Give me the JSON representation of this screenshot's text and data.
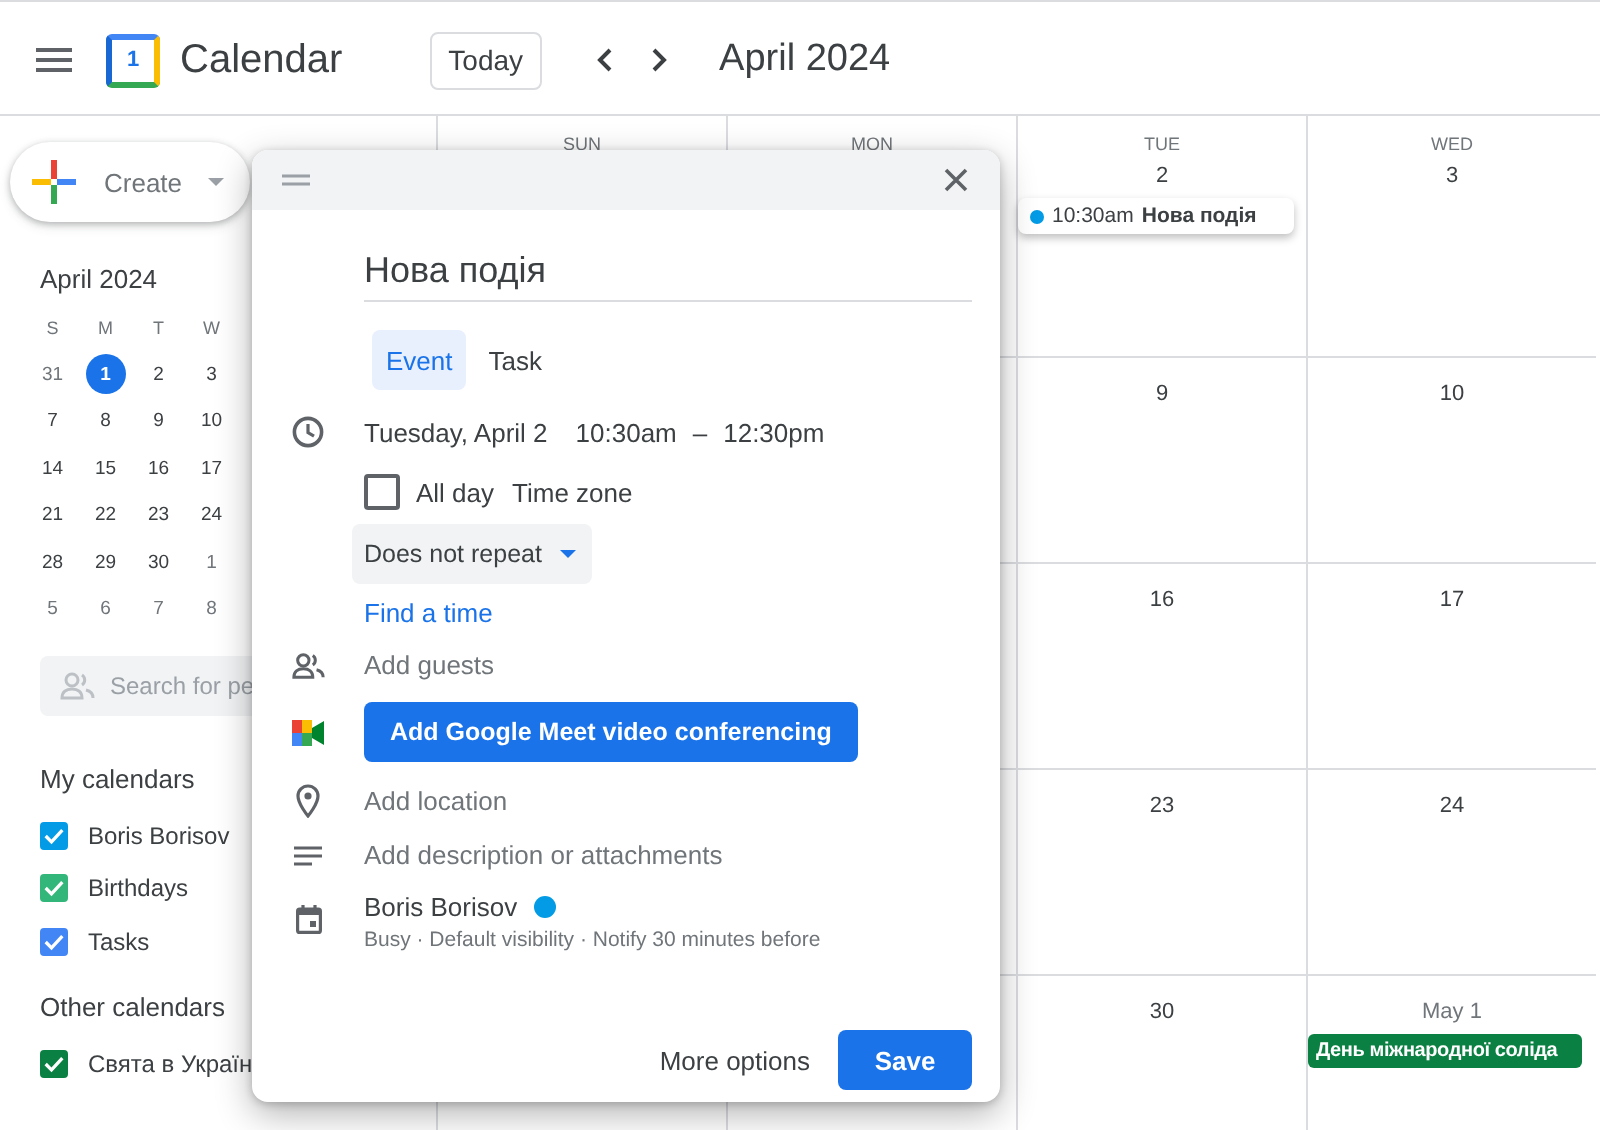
{
  "header": {
    "logo_text": "1",
    "app_name": "Calendar",
    "today_button": "Today",
    "period": "April 2024"
  },
  "sidebar": {
    "create_button": "Create",
    "mini_calendar": {
      "title": "April 2024",
      "weekdays": [
        "S",
        "M",
        "T",
        "W"
      ],
      "weeks": [
        [
          {
            "d": "31",
            "outside": true,
            "today": false
          },
          {
            "d": "1",
            "outside": false,
            "today": true
          },
          {
            "d": "2",
            "outside": false,
            "today": false
          },
          {
            "d": "3",
            "outside": false,
            "today": false
          }
        ],
        [
          {
            "d": "7",
            "outside": false,
            "today": false
          },
          {
            "d": "8",
            "outside": false,
            "today": false
          },
          {
            "d": "9",
            "outside": false,
            "today": false
          },
          {
            "d": "10",
            "outside": false,
            "today": false
          }
        ],
        [
          {
            "d": "14",
            "outside": false,
            "today": false
          },
          {
            "d": "15",
            "outside": false,
            "today": false
          },
          {
            "d": "16",
            "outside": false,
            "today": false
          },
          {
            "d": "17",
            "outside": false,
            "today": false
          }
        ],
        [
          {
            "d": "21",
            "outside": false,
            "today": false
          },
          {
            "d": "22",
            "outside": false,
            "today": false
          },
          {
            "d": "23",
            "outside": false,
            "today": false
          },
          {
            "d": "24",
            "outside": false,
            "today": false
          }
        ],
        [
          {
            "d": "28",
            "outside": false,
            "today": false
          },
          {
            "d": "29",
            "outside": false,
            "today": false
          },
          {
            "d": "30",
            "outside": false,
            "today": false
          },
          {
            "d": "1",
            "outside": true,
            "today": false
          }
        ],
        [
          {
            "d": "5",
            "outside": true,
            "today": false
          },
          {
            "d": "6",
            "outside": true,
            "today": false
          },
          {
            "d": "7",
            "outside": true,
            "today": false
          },
          {
            "d": "8",
            "outside": true,
            "today": false
          }
        ]
      ]
    },
    "search": {
      "placeholder": "Search for pe"
    },
    "my_calendars": {
      "title": "My calendars",
      "items": [
        {
          "label": "Boris Borisov",
          "checked": true,
          "color": "#039be5"
        },
        {
          "label": "Birthdays",
          "checked": true,
          "color": "#33b679"
        },
        {
          "label": "Tasks",
          "checked": true,
          "color": "#4285f4"
        }
      ]
    },
    "other_calendars": {
      "title": "Other calendars",
      "items": [
        {
          "label": "Свята в Україн",
          "checked": true,
          "color": "#0b8043"
        }
      ]
    }
  },
  "grid": {
    "columns": [
      "SUN",
      "MON",
      "TUE",
      "WED"
    ],
    "weeks": [
      {
        "days": [
          {
            "date": "2",
            "outside": false,
            "events": [
              {
                "kind": "timed",
                "time": "10:30am",
                "title": "Нова подія",
                "color": "#039be5"
              }
            ]
          },
          {
            "date": "3",
            "outside": false
          }
        ]
      },
      {
        "days": [
          {
            "date": "9",
            "outside": false
          },
          {
            "date": "10",
            "outside": false
          }
        ]
      },
      {
        "days": [
          {
            "date": "16",
            "outside": false
          },
          {
            "date": "17",
            "outside": false
          }
        ]
      },
      {
        "days": [
          {
            "date": "23",
            "outside": false
          },
          {
            "date": "24",
            "outside": false
          }
        ]
      },
      {
        "days": [
          {
            "date": "30",
            "outside": false
          },
          {
            "date": "May 1",
            "outside": true,
            "events": [
              {
                "kind": "allday",
                "title": "День міжнародної соліда",
                "color": "#0b8043"
              }
            ]
          }
        ]
      }
    ]
  },
  "dialog": {
    "title_value": "Нова подія",
    "tabs": [
      {
        "label": "Event",
        "selected": true
      },
      {
        "label": "Task",
        "selected": false
      }
    ],
    "date": "Tuesday, April 2",
    "start": "10:30am",
    "dash": "–",
    "end": "12:30pm",
    "all_day": {
      "label": "All day",
      "checked": false
    },
    "time_zone": "Time zone",
    "repeat": "Does not repeat",
    "find_time": "Find a time",
    "guests_placeholder": "Add guests",
    "meet_button": "Add Google Meet video conferencing",
    "location_placeholder": "Add location",
    "description_placeholder": "Add description or attachments",
    "calendar": {
      "name": "Boris Borisov",
      "color": "#039be5",
      "details": "Busy · Default visibility · Notify 30 minutes before"
    },
    "more_options": "More options",
    "save": "Save"
  }
}
